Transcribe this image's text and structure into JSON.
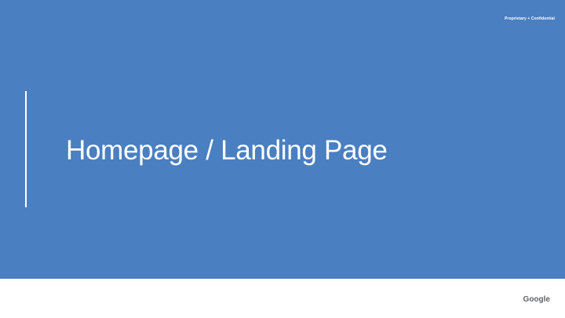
{
  "slide": {
    "confidential_label": "Proprietary + Confidential",
    "title": "Homepage / Landing Page"
  },
  "footer": {
    "logo_text": "Google"
  },
  "colors": {
    "title_background": "#4a7fc1",
    "text_on_blue": "#ffffff",
    "footer_background": "#ffffff",
    "logo": "#5f6368"
  }
}
